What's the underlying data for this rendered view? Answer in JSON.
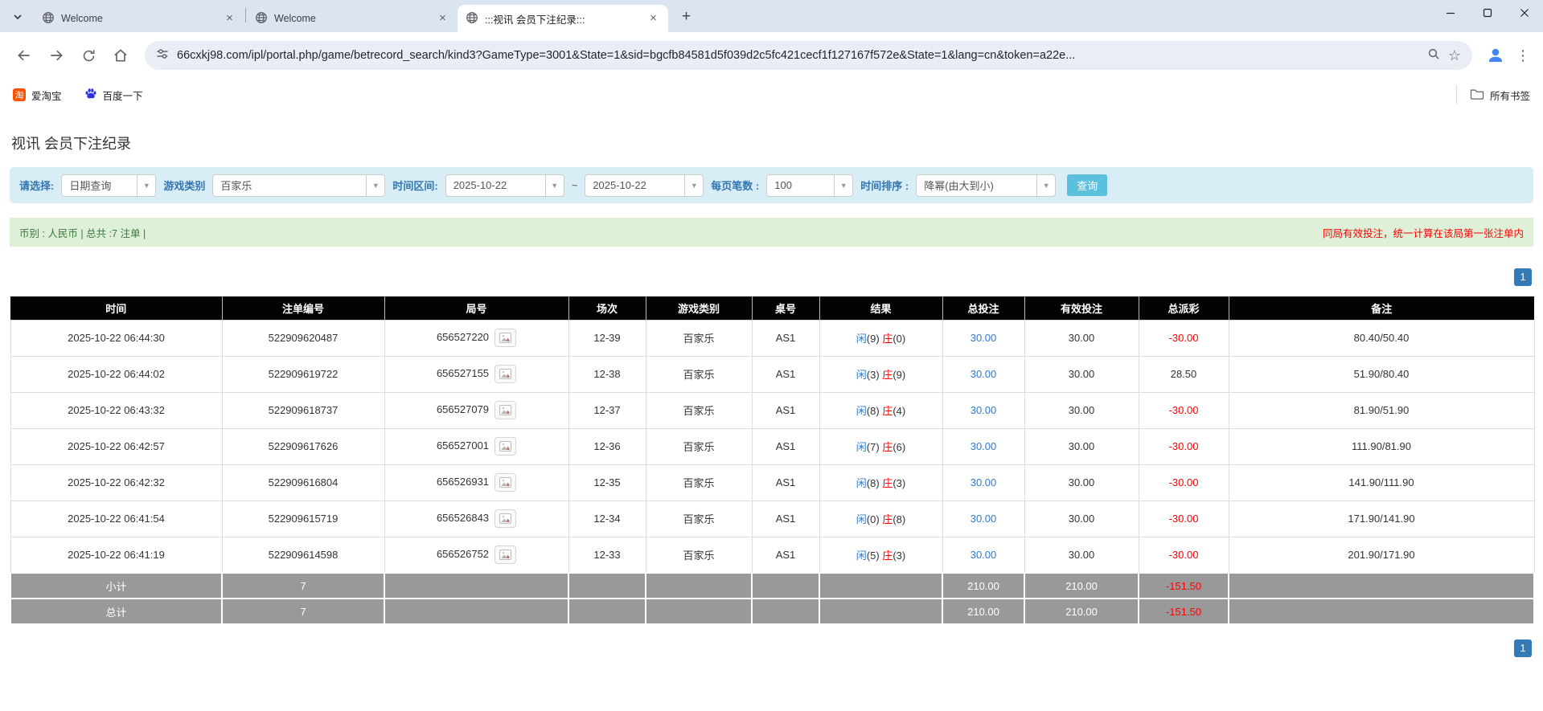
{
  "browser": {
    "tabs": [
      {
        "title": "Welcome"
      },
      {
        "title": "Welcome"
      },
      {
        "title": ":::视讯 会员下注纪录:::"
      }
    ],
    "url": "66cxkj98.com/ipl/portal.php/game/betrecord_search/kind3?GameType=3001&State=1&sid=bgcfb84581d5f039d2c5fc421cecf1f127167f572e&State=1&lang=cn&token=a22e...",
    "bookmarks": [
      {
        "label": "爱淘宝",
        "icon": "taobao-icon"
      },
      {
        "label": "百度一下",
        "icon": "baidu-paw-icon"
      }
    ],
    "all_bookmarks_label": "所有书签"
  },
  "page": {
    "title": "视讯 会员下注纪录",
    "filters": {
      "select_label": "请选择:",
      "select_value": "日期查询",
      "game_type_label": "游戏类别",
      "game_type_value": "百家乐",
      "date_range_label": "时间区间:",
      "date_from": "2025-10-22",
      "range_separator": "~",
      "date_to": "2025-10-22",
      "per_page_label": "每页笔数 :",
      "per_page_value": "100",
      "sort_label": "时间排序 :",
      "sort_value": "降幂(由大到小)",
      "search_button": "查询"
    },
    "summary": {
      "left": "币别 : 人民币 | 总共 :7 注单 |",
      "right_note": "同局有效投注，统一计算在该局第一张注单内"
    },
    "pagination": {
      "current": "1"
    },
    "table": {
      "headers": [
        "时间",
        "注单编号",
        "局号",
        "场次",
        "游戏类别",
        "桌号",
        "结果",
        "总投注",
        "有效投注",
        "总派彩",
        "备注"
      ],
      "result_labels": {
        "player": "闲",
        "banker": "庄"
      },
      "rows": [
        {
          "time": "2025-10-22 06:44:30",
          "bet_no": "522909620487",
          "round_no": "656527220",
          "session": "12-39",
          "game": "百家乐",
          "table_no": "AS1",
          "result_player": "9",
          "result_banker": "0",
          "total_bet": "30.00",
          "valid_bet": "30.00",
          "payout": "-30.00",
          "remark": "80.40/50.40"
        },
        {
          "time": "2025-10-22 06:44:02",
          "bet_no": "522909619722",
          "round_no": "656527155",
          "session": "12-38",
          "game": "百家乐",
          "table_no": "AS1",
          "result_player": "3",
          "result_banker": "9",
          "total_bet": "30.00",
          "valid_bet": "30.00",
          "payout": "28.50",
          "remark": "51.90/80.40"
        },
        {
          "time": "2025-10-22 06:43:32",
          "bet_no": "522909618737",
          "round_no": "656527079",
          "session": "12-37",
          "game": "百家乐",
          "table_no": "AS1",
          "result_player": "8",
          "result_banker": "4",
          "total_bet": "30.00",
          "valid_bet": "30.00",
          "payout": "-30.00",
          "remark": "81.90/51.90"
        },
        {
          "time": "2025-10-22 06:42:57",
          "bet_no": "522909617626",
          "round_no": "656527001",
          "session": "12-36",
          "game": "百家乐",
          "table_no": "AS1",
          "result_player": "7",
          "result_banker": "6",
          "total_bet": "30.00",
          "valid_bet": "30.00",
          "payout": "-30.00",
          "remark": "111.90/81.90"
        },
        {
          "time": "2025-10-22 06:42:32",
          "bet_no": "522909616804",
          "round_no": "656526931",
          "session": "12-35",
          "game": "百家乐",
          "table_no": "AS1",
          "result_player": "8",
          "result_banker": "3",
          "total_bet": "30.00",
          "valid_bet": "30.00",
          "payout": "-30.00",
          "remark": "141.90/111.90"
        },
        {
          "time": "2025-10-22 06:41:54",
          "bet_no": "522909615719",
          "round_no": "656526843",
          "session": "12-34",
          "game": "百家乐",
          "table_no": "AS1",
          "result_player": "0",
          "result_banker": "8",
          "total_bet": "30.00",
          "valid_bet": "30.00",
          "payout": "-30.00",
          "remark": "171.90/141.90"
        },
        {
          "time": "2025-10-22 06:41:19",
          "bet_no": "522909614598",
          "round_no": "656526752",
          "session": "12-33",
          "game": "百家乐",
          "table_no": "AS1",
          "result_player": "5",
          "result_banker": "3",
          "total_bet": "30.00",
          "valid_bet": "30.00",
          "payout": "-30.00",
          "remark": "201.90/171.90"
        }
      ],
      "footer_rows": [
        {
          "label": "小计",
          "count": "7",
          "total_bet": "210.00",
          "valid_bet": "210.00",
          "payout": "-151.50"
        },
        {
          "label": "总计",
          "count": "7",
          "total_bet": "210.00",
          "valid_bet": "210.00",
          "payout": "-151.50"
        }
      ]
    }
  },
  "colors": {
    "chromeBg": "#dce3f1",
    "accentBlue": "#337ab7",
    "buttonBlue": "#5bc0de",
    "filterPanelBg": "#d9edf7",
    "filterLabelBlue": "#3276b1",
    "summaryBarBg": "#dff0d8",
    "summaryTextGreen": "#3c763d",
    "noteRed": "#ff0000",
    "negativeRed": "#ff0000",
    "playerBlue": "#2d7bd0",
    "bankerRed": "#ff0000",
    "linkBlue": "#2d7bd0",
    "tableHeaderBg": "#030303",
    "footerRowBg": "#999999",
    "profileBlue": "#4285f4"
  }
}
